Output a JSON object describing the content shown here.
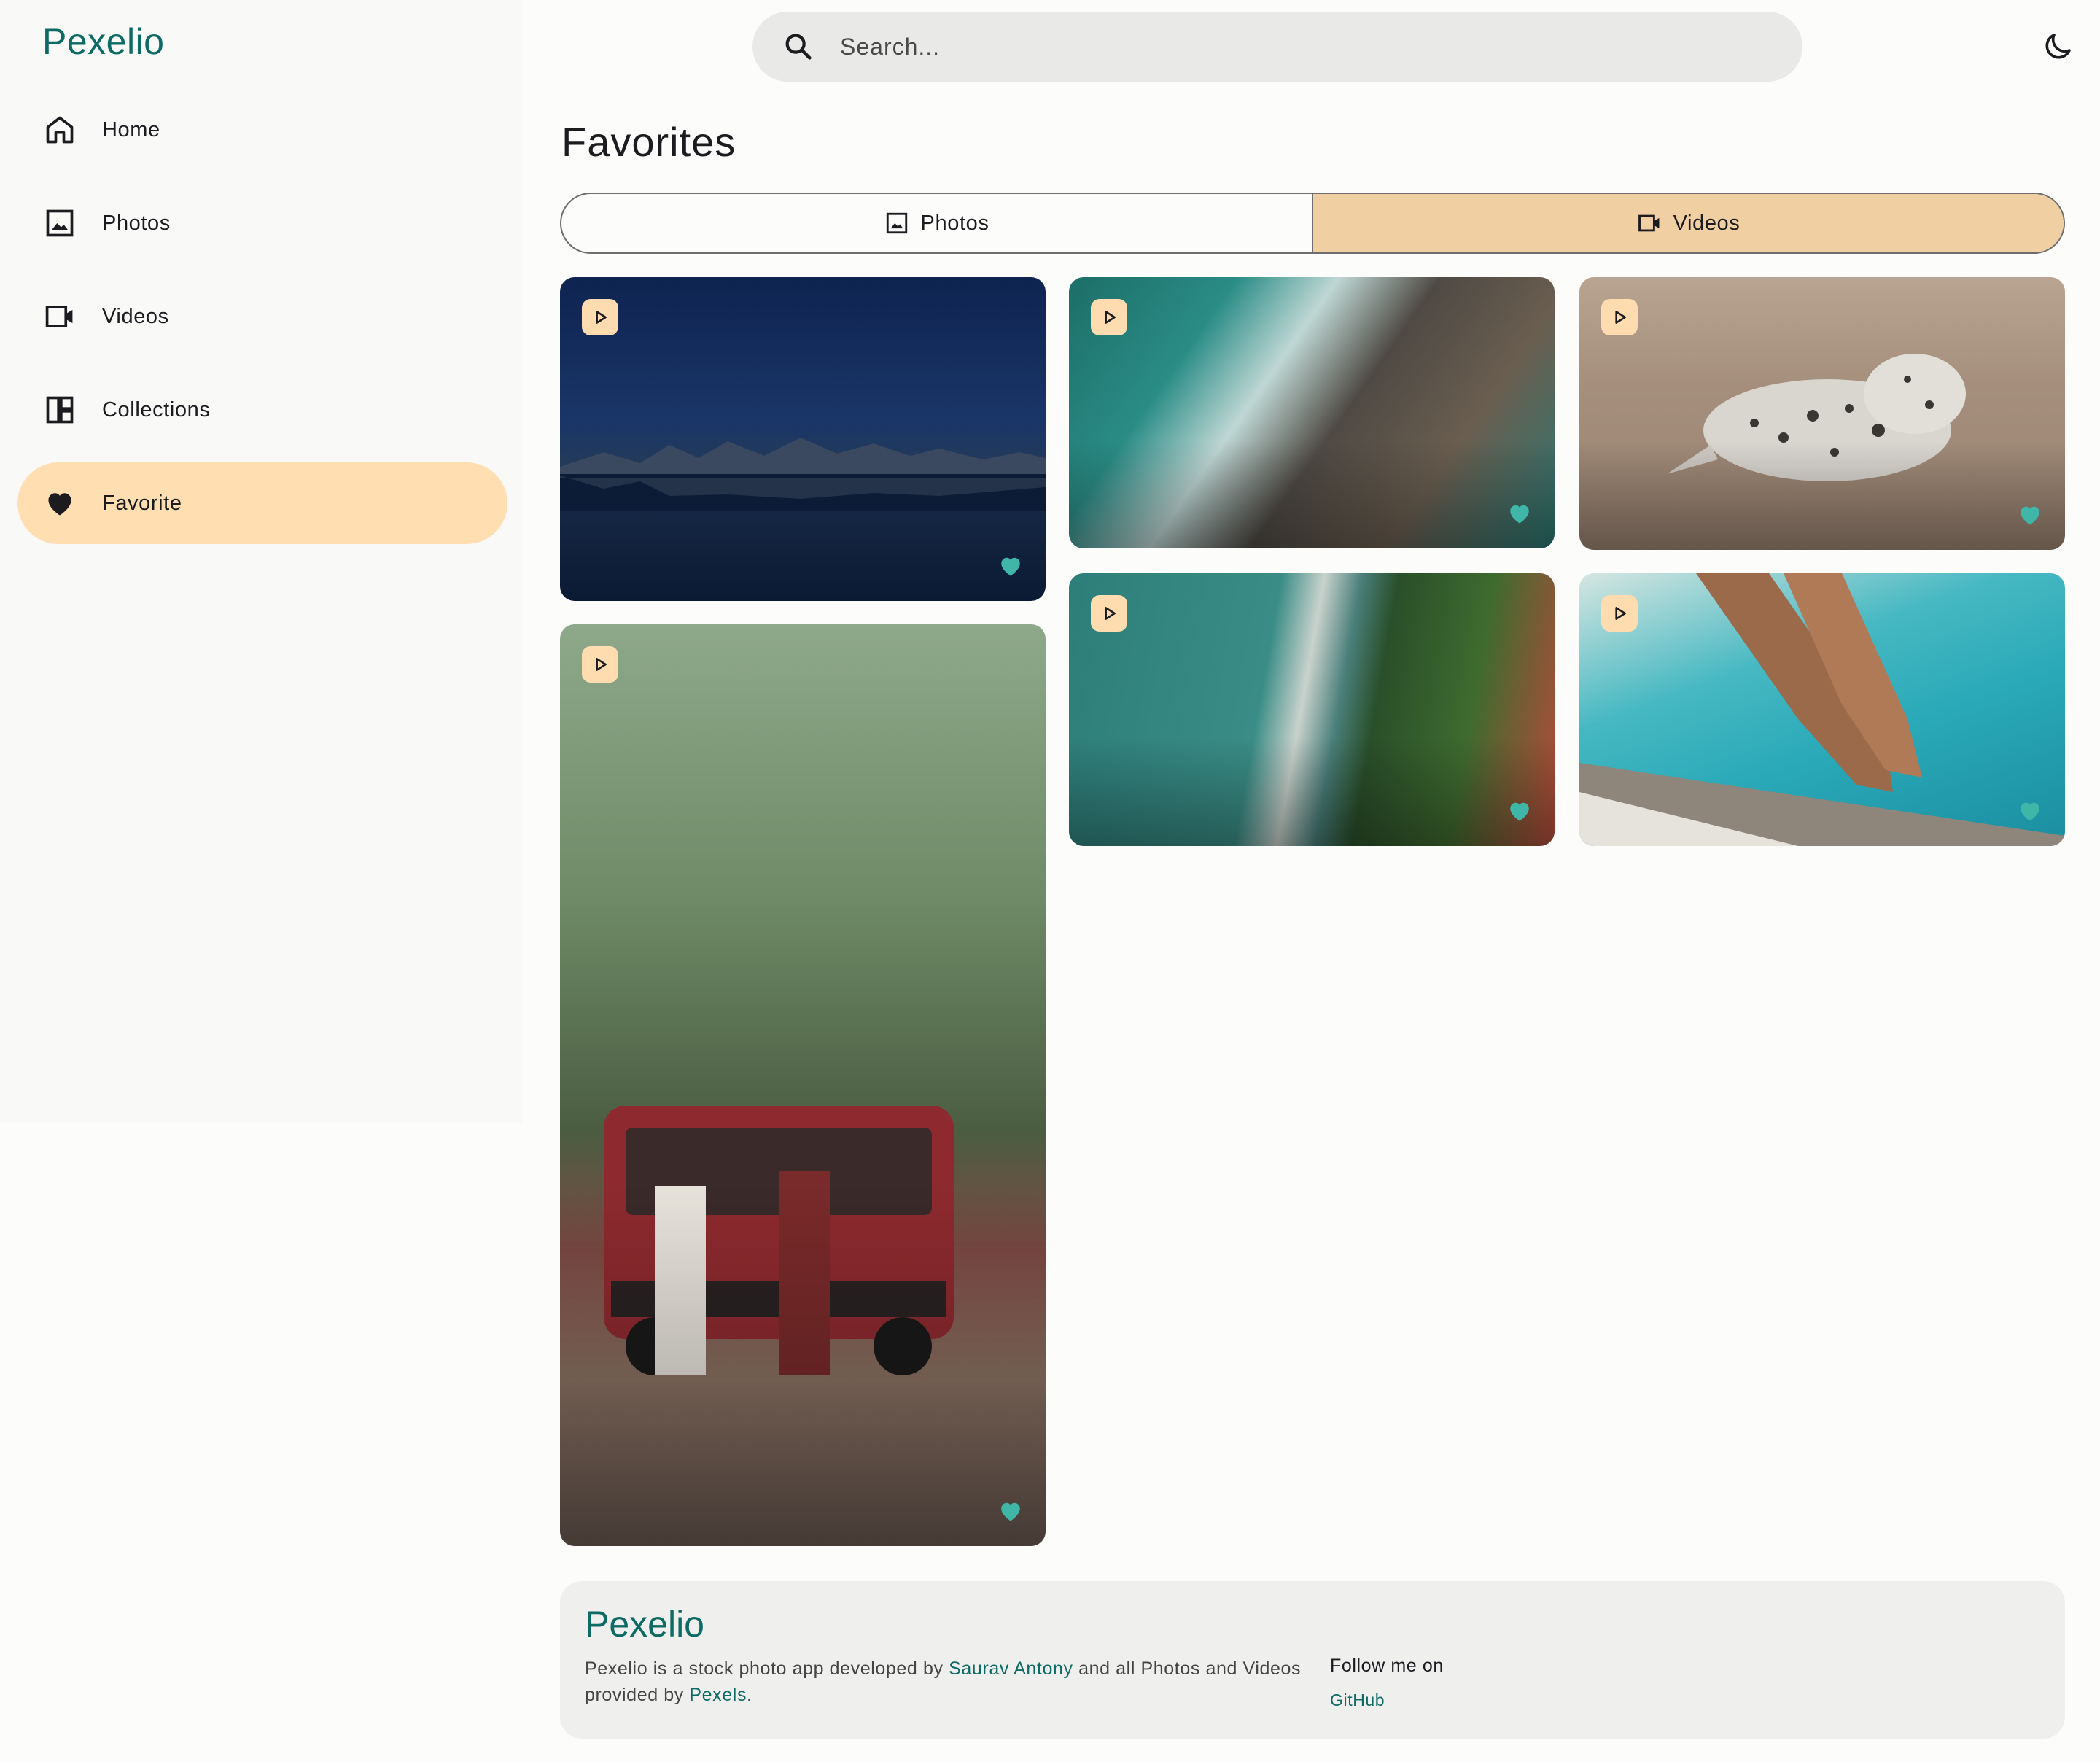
{
  "app": {
    "logo": "Pexelio"
  },
  "search": {
    "placeholder": "Search..."
  },
  "sidebar": {
    "items": [
      {
        "label": "Home",
        "icon": "home-icon",
        "active": false
      },
      {
        "label": "Photos",
        "icon": "image-icon",
        "active": false
      },
      {
        "label": "Videos",
        "icon": "videocam-icon",
        "active": false
      },
      {
        "label": "Collections",
        "icon": "dashboard-icon",
        "active": false
      },
      {
        "label": "Favorite",
        "icon": "heart-icon",
        "active": true
      }
    ]
  },
  "main": {
    "title": "Favorites",
    "tabs": [
      {
        "label": "Photos",
        "icon": "image-icon",
        "active": false
      },
      {
        "label": "Videos",
        "icon": "videocam-icon",
        "active": true
      }
    ],
    "cards": [
      {
        "subject": "night mountain lake",
        "type": "video",
        "favorited": true
      },
      {
        "subject": "aerial ocean waves on rocks",
        "type": "video",
        "favorited": true
      },
      {
        "subject": "seal on beach",
        "type": "video",
        "favorited": true
      },
      {
        "subject": "couple by red van in forest",
        "type": "video",
        "favorited": true
      },
      {
        "subject": "aerial coastline with forest",
        "type": "video",
        "favorited": true
      },
      {
        "subject": "legs by swimming pool",
        "type": "video",
        "favorited": true
      }
    ]
  },
  "footer": {
    "logo": "Pexelio",
    "desc_prefix": "Pexelio is a stock photo app developed by ",
    "author": "Saurav Antony",
    "desc_middle": " and all Photos and Videos provided by ",
    "provider": "Pexels",
    "desc_suffix": ".",
    "follow_label": "Follow me on",
    "github_label": "GitHub"
  },
  "colors": {
    "accent": "#0d6a64",
    "active_bg": "#ffdfb1",
    "tab_active": "#f0cfa2",
    "heart": "#3fb6a8",
    "play_bg": "#ffdcb0"
  }
}
